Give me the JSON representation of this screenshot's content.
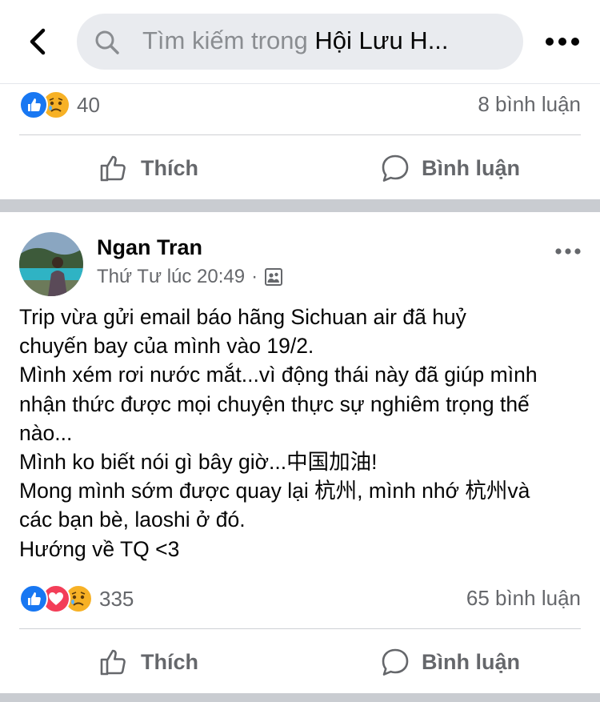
{
  "header": {
    "search_prefix": "Tìm kiếm trong ",
    "search_group": "Hội Lưu H..."
  },
  "prev_post": {
    "reaction_count": "40",
    "comment_count": "8 bình luận",
    "like_label": "Thích",
    "comment_label": "Bình luận"
  },
  "post": {
    "author": "Ngan Tran",
    "timestamp": "Thứ Tư lúc 20:49",
    "dot": "·",
    "lines": [
      "Trip vừa gửi email báo hãng Sichuan air đã huỷ",
      "chuyến bay của mình vào 19/2.",
      "Mình xém rơi nước mắt...vì động thái này đã giúp mình",
      "nhận  thức được mọi chuyện thực sự nghiêm trọng thế",
      "nào...",
      "Mình ko biết nói gì bây giờ...中国加油!",
      "Mong mình sớm được quay lại 杭州, mình nhớ 杭州và",
      "các bạn bè, laoshi ở đó.",
      "Hướng về TQ <3"
    ],
    "reaction_count": "335",
    "comment_count": "65 bình luận",
    "like_label": "Thích",
    "comment_label": "Bình luận"
  },
  "colors": {
    "like_blue": "#1877f2",
    "love_red": "#f33e58",
    "sad_yellow": "#f7b125",
    "muted_text": "#65676b",
    "section_gap": "#c9ccd1"
  },
  "icons": [
    "back-arrow-icon",
    "search-icon",
    "more-icon",
    "like-reaction-icon",
    "love-reaction-icon",
    "sad-reaction-icon",
    "thumbs-up-icon",
    "comment-bubble-icon",
    "group-audience-icon"
  ]
}
